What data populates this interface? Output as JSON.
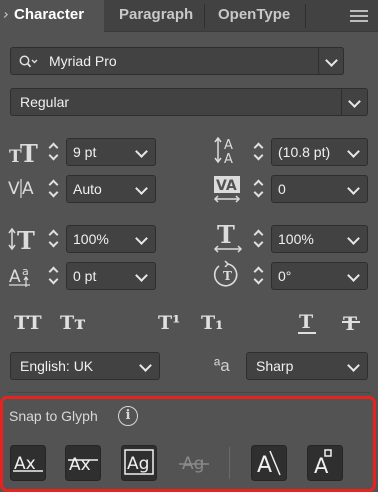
{
  "tabs": [
    {
      "label": "Character",
      "active": true
    },
    {
      "label": "Paragraph",
      "active": false
    },
    {
      "label": "OpenType",
      "active": false
    }
  ],
  "font_family": {
    "value": "Myriad Pro",
    "icon": "search-icon"
  },
  "font_style": {
    "value": "Regular"
  },
  "controls": {
    "font_size": {
      "value": "9 pt",
      "icon": "font-size-icon"
    },
    "leading": {
      "value": "(10.8 pt)",
      "icon": "leading-icon"
    },
    "kerning": {
      "value": "Auto",
      "icon": "kerning-icon"
    },
    "tracking": {
      "value": "0",
      "icon": "tracking-icon"
    },
    "vertical_scale": {
      "value": "100%",
      "icon": "vertical-scale-icon"
    },
    "horizontal_scale": {
      "value": "100%",
      "icon": "horizontal-scale-icon"
    },
    "baseline_shift": {
      "value": "0 pt",
      "icon": "baseline-shift-icon"
    },
    "character_rotation": {
      "value": "0°",
      "icon": "character-rotation-icon"
    }
  },
  "type_buttons": {
    "all_caps": "TT",
    "small_caps": "Tт",
    "superscript": "T¹",
    "subscript": "T₁"
  },
  "language": {
    "value": "English: UK"
  },
  "anti_aliasing": {
    "value": "Sharp",
    "icon_text": "ªa"
  },
  "snap_to_glyph": {
    "title": "Snap to Glyph",
    "info_icon": "i",
    "buttons": [
      {
        "name": "baseline",
        "text": "Ax"
      },
      {
        "name": "x-height",
        "text": "Ax"
      },
      {
        "name": "glyph-bounds",
        "text": "Ag"
      },
      {
        "name": "proximity-guides",
        "text": "Ag"
      },
      {
        "name": "angular-guides",
        "text": "A"
      },
      {
        "name": "anchor-point",
        "text": "A"
      }
    ]
  },
  "colors": {
    "highlight": "#e8221f",
    "panel_bg": "#535353",
    "field_bg": "#424242"
  }
}
